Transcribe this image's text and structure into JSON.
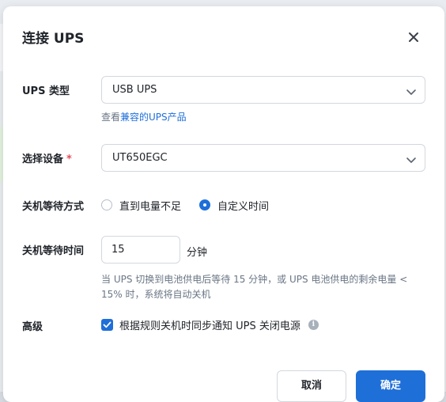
{
  "dialog": {
    "title": "连接 UPS"
  },
  "form": {
    "ups_type": {
      "label": "UPS 类型",
      "value": "USB UPS"
    },
    "compat_link": {
      "prefix": "查看",
      "link_text": "兼容的UPS产品"
    },
    "device": {
      "label": "选择设备",
      "required_mark": "*",
      "value": "UT650EGC"
    },
    "shutdown_mode": {
      "label": "关机等待方式",
      "options": [
        {
          "label": "直到电量不足",
          "checked": false
        },
        {
          "label": "自定义时间",
          "checked": true
        }
      ]
    },
    "wait_time": {
      "label": "关机等待时间",
      "value": "15",
      "unit": "分钟",
      "hint": "当 UPS 切换到电池供电后等待 15 分钟，或 UPS 电池供电的剩余电量 < 15% 时，系统将自动关机"
    },
    "advanced": {
      "label": "高级",
      "checkbox_label": "根据规则关机时同步通知 UPS 关闭电源",
      "checked": true
    }
  },
  "buttons": {
    "cancel": "取消",
    "ok": "确定"
  },
  "colors": {
    "accent": "#1f6fd8",
    "required": "#e34d59"
  },
  "icons": {
    "close": "close-icon",
    "dropdown": "chevron-down-icon",
    "info": "info-icon",
    "check": "check-icon"
  }
}
